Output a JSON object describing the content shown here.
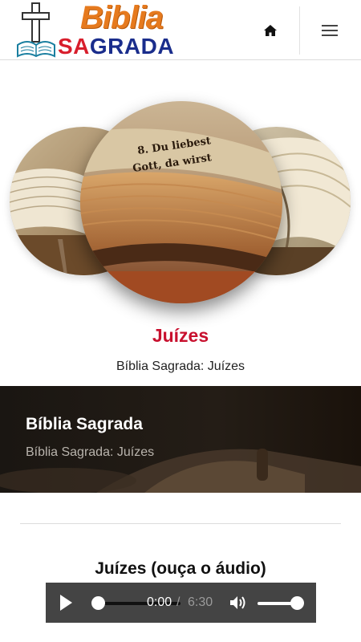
{
  "header": {
    "logo_line1": "Biblia",
    "logo_line2_red": "SA",
    "logo_line2_blue": "GRADA",
    "home_icon": "home-icon",
    "menu_icon": "hamburger-menu-icon"
  },
  "hero": {
    "images": [
      "open-bible-left",
      "old-book-center",
      "open-book-right"
    ],
    "center_image_text": [
      "8. Du liebest",
      "Gott, da wirst"
    ]
  },
  "content": {
    "chapter_title": "Juízes",
    "chapter_subtitle": "Bíblia Sagrada: Juízes"
  },
  "banner": {
    "title": "Bíblia Sagrada",
    "subtitle": "Bíblia Sagrada: Juízes"
  },
  "audio": {
    "title": "Juízes (ouça o áudio)",
    "current_time": "0:00",
    "separator": "/",
    "duration": "6:30",
    "progress": 0,
    "volume": 1.0,
    "play_icon": "play-icon",
    "volume_icon": "volume-icon"
  },
  "colors": {
    "accent_red": "#c8102e",
    "logo_orange": "#e67a1e",
    "logo_blue": "#1a2d8c",
    "player_bg": "#444444"
  }
}
